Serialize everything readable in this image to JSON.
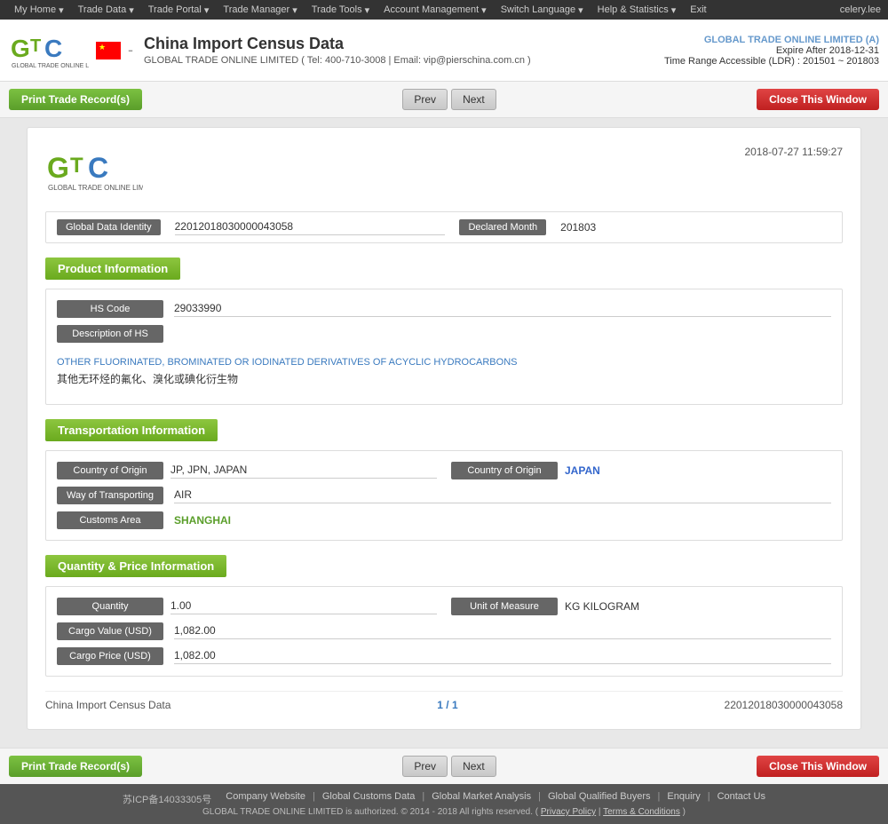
{
  "nav": {
    "items": [
      {
        "label": "My Home",
        "hasArrow": true
      },
      {
        "label": "Trade Data",
        "hasArrow": true
      },
      {
        "label": "Trade Portal",
        "hasArrow": true
      },
      {
        "label": "Trade Manager",
        "hasArrow": true
      },
      {
        "label": "Trade Tools",
        "hasArrow": true
      },
      {
        "label": "Account Management",
        "hasArrow": true
      },
      {
        "label": "Switch Language",
        "hasArrow": true
      },
      {
        "label": "Help & Statistics",
        "hasArrow": true
      },
      {
        "label": "Exit",
        "hasArrow": false
      }
    ],
    "user": "celery.lee"
  },
  "header": {
    "title": "China Import Census Data",
    "dash": "-",
    "subtitle": "GLOBAL TRADE ONLINE LIMITED ( Tel: 400-710-3008 | Email: vip@pierschina.com.cn )",
    "company_link": "GLOBAL TRADE ONLINE LIMITED (A)",
    "expire": "Expire After 2018-12-31",
    "time_range": "Time Range Accessible (LDR) : 201501 ~ 201803"
  },
  "toolbar": {
    "print_label": "Print Trade Record(s)",
    "prev_label": "Prev",
    "next_label": "Next",
    "close_label": "Close This Window"
  },
  "record": {
    "datetime": "2018-07-27 11:59:27",
    "global_data_identity_label": "Global Data Identity",
    "global_data_identity_value": "22012018030000043058",
    "declared_month_label": "Declared Month",
    "declared_month_value": "201803",
    "sections": {
      "product": {
        "header": "Product Information",
        "hs_code_label": "HS Code",
        "hs_code_value": "29033990",
        "desc_hs_label": "Description of HS",
        "desc_en": "OTHER FLUORINATED, BROMINATED OR IODINATED DERIVATIVES OF ACYCLIC HYDROCARBONS",
        "desc_zh": "其他无环烃的氟化、溴化或碘化衍生物"
      },
      "transport": {
        "header": "Transportation Information",
        "country_of_origin_label": "Country of Origin",
        "country_of_origin_value": "JP, JPN, JAPAN",
        "country_of_origin2_label": "Country of Origin",
        "country_of_origin2_value": "JAPAN",
        "way_of_transporting_label": "Way of Transporting",
        "way_of_transporting_value": "AIR",
        "customs_area_label": "Customs Area",
        "customs_area_value": "SHANGHAI"
      },
      "quantity": {
        "header": "Quantity & Price Information",
        "quantity_label": "Quantity",
        "quantity_value": "1.00",
        "unit_of_measure_label": "Unit of Measure",
        "unit_of_measure_value": "KG KILOGRAM",
        "cargo_value_label": "Cargo Value (USD)",
        "cargo_value_value": "1,082.00",
        "cargo_price_label": "Cargo Price (USD)",
        "cargo_price_value": "1,082.00"
      }
    },
    "footer": {
      "left": "China Import Census Data",
      "center": "1 / 1",
      "right": "22012018030000043058"
    }
  },
  "footer": {
    "icp": "苏ICP备14033305号",
    "links": [
      {
        "label": "Company Website"
      },
      {
        "label": "Global Customs Data"
      },
      {
        "label": "Global Market Analysis"
      },
      {
        "label": "Global Qualified Buyers"
      },
      {
        "label": "Enquiry"
      },
      {
        "label": "Contact Us"
      }
    ],
    "copyright": "GLOBAL TRADE ONLINE LIMITED is authorized. © 2014 - 2018 All rights reserved.",
    "privacy": "Privacy Policy",
    "conditions": "Terms & Conditions"
  }
}
